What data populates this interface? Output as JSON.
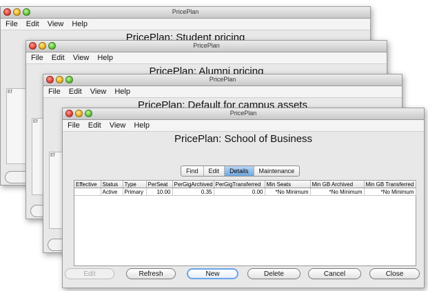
{
  "menus": [
    "File",
    "Edit",
    "View",
    "Help"
  ],
  "windows": [
    {
      "title": "PricePlan",
      "heading": "PricePlan: Student pricing"
    },
    {
      "title": "PricePlan",
      "heading": "PricePlan: Alumni pricing"
    },
    {
      "title": "PricePlan",
      "heading": "PricePlan: Default for campus assets"
    },
    {
      "title": "PricePlan",
      "heading": "PricePlan: School of Business"
    }
  ],
  "ghost_label": "Ef",
  "tabs": [
    "Find",
    "Edit",
    "Details",
    "Maintenance"
  ],
  "active_tab": "Details",
  "table": {
    "columns": [
      "Effective",
      "Status",
      "Type",
      "PerSeat",
      "PerGigArchived",
      "PerGigTransferred",
      "Min Seats",
      "Min GB Archived",
      "Min GB Transferred"
    ],
    "rows": [
      [
        "",
        "Active",
        "Primary",
        "10.00",
        "0.35",
        "0.00",
        "*No Minimum",
        "*No Minimum",
        "*No Minimum"
      ]
    ]
  },
  "buttons": {
    "edit": "Edit",
    "refresh": "Refresh",
    "new": "New",
    "delete": "Delete",
    "cancel": "Cancel",
    "close": "Close"
  },
  "colors": {
    "accent": "#6aa4e8",
    "close_light": "#e0443a",
    "minimize_light": "#e8b020",
    "zoom_light": "#5cc23a"
  }
}
